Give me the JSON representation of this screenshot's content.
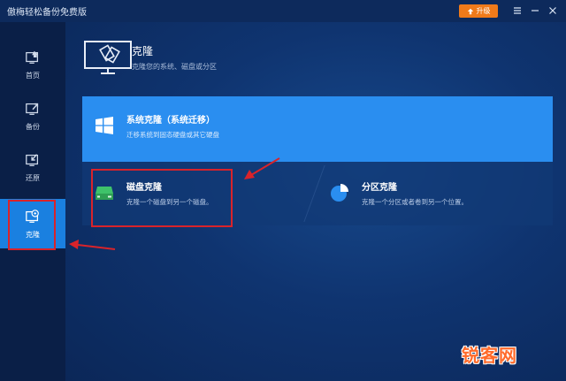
{
  "app": {
    "title": "傲梅轻松备份免费版",
    "upgrade_label": "升级"
  },
  "sidebar": {
    "items": [
      {
        "label": "首页",
        "icon": "home-icon"
      },
      {
        "label": "备份",
        "icon": "backup-icon"
      },
      {
        "label": "还原",
        "icon": "restore-icon"
      },
      {
        "label": "克隆",
        "icon": "clone-icon",
        "active": true
      }
    ]
  },
  "header": {
    "title": "克隆",
    "subtitle": "克隆您的系统、磁盘或分区"
  },
  "cards": {
    "system": {
      "title": "系统克隆（系统迁移）",
      "desc": "迁移系统到固态硬盘或其它硬盘"
    },
    "disk": {
      "title": "磁盘克隆",
      "desc": "克隆一个磁盘到另一个磁盘。"
    },
    "partition": {
      "title": "分区克隆",
      "desc": "克隆一个分区或者卷到另一个位置。"
    }
  },
  "watermark": "锐客网",
  "colors": {
    "accent": "#1a80e0",
    "card_active": "#2a8ef0",
    "upgrade": "#ef7a1a",
    "highlight": "#d9232a",
    "disk_icon": "#3ec26a"
  }
}
